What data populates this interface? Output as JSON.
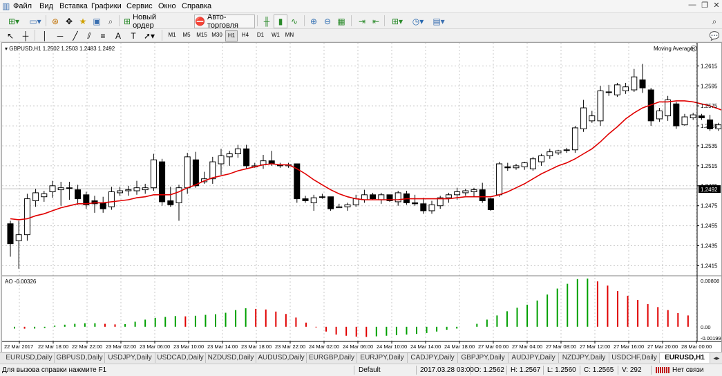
{
  "menu": {
    "items": [
      "Файл",
      "Вид",
      "Вставка",
      "Графики",
      "Сервис",
      "Окно",
      "Справка"
    ],
    "window_buttons": [
      "—",
      "❐",
      "✕"
    ]
  },
  "toolbar": {
    "new_order_label": "Новый ордер",
    "auto_trading_label": "Авто-торговля",
    "timeframes": [
      "M1",
      "M5",
      "M15",
      "M30",
      "H1",
      "H4",
      "D1",
      "W1",
      "MN"
    ],
    "active_timeframe": "H1"
  },
  "chart": {
    "header": "GBPUSD,H1  1.2502 1.2503 1.2483 1.2492",
    "indicator_label": "Moving Average",
    "ao_label": "AO -0.00326",
    "current_price_label": "1.2492",
    "colors": {
      "up": "#00a000",
      "down": "#e00000",
      "ma": "#e00000",
      "bid_line": "#c0c0c0"
    }
  },
  "chart_data": {
    "type": "candlestick",
    "symbol": "GBPUSD",
    "timeframe": "H1",
    "price_axis": {
      "ylim": [
        1.2407,
        1.2627
      ],
      "ticks": [
        "1.2615",
        "1.2595",
        "1.2575",
        "1.2555",
        "1.2535",
        "1.2515",
        "1.2495",
        "1.2475",
        "1.2455",
        "1.2435",
        "1.2415"
      ]
    },
    "current_price": 1.2492,
    "time_labels": [
      "22 Mar 2017",
      "22 Mar 18:00",
      "22 Mar 22:00",
      "23 Mar 02:00",
      "23 Mar 06:00",
      "23 Mar 10:00",
      "23 Mar 14:00",
      "23 Mar 18:00",
      "23 Mar 22:00",
      "24 Mar 02:00",
      "24 Mar 06:00",
      "24 Mar 10:00",
      "24 Mar 14:00",
      "24 Mar 18:00",
      "27 Mar 00:00",
      "27 Mar 04:00",
      "27 Mar 08:00",
      "27 Mar 12:00",
      "27 Mar 16:00",
      "27 Mar 20:00",
      "28 Mar 00:00"
    ],
    "candles": [
      [
        1.2457,
        1.246,
        1.2424,
        1.2437
      ],
      [
        1.244,
        1.246,
        1.2412,
        1.2446
      ],
      [
        1.2446,
        1.2487,
        1.244,
        1.2482
      ],
      [
        1.248,
        1.2492,
        1.2474,
        1.2488
      ],
      [
        1.2484,
        1.249,
        1.2479,
        1.2487
      ],
      [
        1.2489,
        1.25,
        1.2483,
        1.2495
      ],
      [
        1.2491,
        1.2499,
        1.2475,
        1.2493
      ],
      [
        1.2493,
        1.2499,
        1.2481,
        1.2493
      ],
      [
        1.2491,
        1.2496,
        1.2476,
        1.2482
      ],
      [
        1.2486,
        1.2489,
        1.2472,
        1.2476
      ],
      [
        1.248,
        1.2485,
        1.2468,
        1.2477
      ],
      [
        1.2478,
        1.2484,
        1.2468,
        1.2472
      ],
      [
        1.2474,
        1.2494,
        1.2471,
        1.2489
      ],
      [
        1.2488,
        1.2494,
        1.2485,
        1.249
      ],
      [
        1.249,
        1.2495,
        1.2485,
        1.2491
      ],
      [
        1.249,
        1.25,
        1.2486,
        1.2493
      ],
      [
        1.2491,
        1.2497,
        1.2487,
        1.2493
      ],
      [
        1.2493,
        1.2527,
        1.249,
        1.2521
      ],
      [
        1.2519,
        1.2522,
        1.2475,
        1.2479
      ],
      [
        1.248,
        1.2494,
        1.2474,
        1.2476
      ],
      [
        1.2478,
        1.2496,
        1.246,
        1.2493
      ],
      [
        1.2493,
        1.2528,
        1.2487,
        1.2524
      ],
      [
        1.2521,
        1.2529,
        1.2493,
        1.2495
      ],
      [
        1.2499,
        1.2509,
        1.2497,
        1.2502
      ],
      [
        1.2502,
        1.2524,
        1.2497,
        1.2519
      ],
      [
        1.2517,
        1.2532,
        1.2506,
        1.2525
      ],
      [
        1.2524,
        1.253,
        1.2515,
        1.2527
      ],
      [
        1.2527,
        1.2536,
        1.2523,
        1.2532
      ],
      [
        1.2532,
        1.2536,
        1.2512,
        1.2515
      ],
      [
        1.2514,
        1.2518,
        1.2513,
        1.2515
      ],
      [
        1.2516,
        1.2526,
        1.2512,
        1.252
      ],
      [
        1.252,
        1.253,
        1.2515,
        1.2517
      ],
      [
        1.2516,
        1.2518,
        1.2513,
        1.2515
      ],
      [
        1.2515,
        1.2518,
        1.2513,
        1.2516
      ],
      [
        1.2517,
        1.2517,
        1.2478,
        1.2482
      ],
      [
        1.2482,
        1.2485,
        1.2478,
        1.248
      ],
      [
        1.2478,
        1.2486,
        1.247,
        1.2483
      ],
      [
        1.2484,
        1.2487,
        1.2482,
        1.2484
      ],
      [
        1.2484,
        1.2484,
        1.247,
        1.2472
      ],
      [
        1.2473,
        1.2477,
        1.2473,
        1.2474
      ],
      [
        1.2474,
        1.2478,
        1.247,
        1.2476
      ],
      [
        1.2476,
        1.2486,
        1.2474,
        1.2482
      ],
      [
        1.2481,
        1.2491,
        1.2478,
        1.2486
      ],
      [
        1.2486,
        1.2488,
        1.2481,
        1.2482
      ],
      [
        1.2481,
        1.2488,
        1.2477,
        1.2486
      ],
      [
        1.2486,
        1.2486,
        1.2479,
        1.248
      ],
      [
        1.2479,
        1.249,
        1.2475,
        1.2488
      ],
      [
        1.2487,
        1.249,
        1.2476,
        1.2478
      ],
      [
        1.2478,
        1.2486,
        1.2475,
        1.2477
      ],
      [
        1.2477,
        1.2483,
        1.2467,
        1.247
      ],
      [
        1.247,
        1.248,
        1.2467,
        1.2476
      ],
      [
        1.2475,
        1.2485,
        1.2472,
        1.2483
      ],
      [
        1.2483,
        1.2488,
        1.2478,
        1.2486
      ],
      [
        1.2486,
        1.2493,
        1.2481,
        1.2489
      ],
      [
        1.2488,
        1.2492,
        1.2485,
        1.249
      ],
      [
        1.2489,
        1.2493,
        1.2484,
        1.2491
      ],
      [
        1.2491,
        1.2498,
        1.2478,
        1.248
      ],
      [
        1.2482,
        1.2483,
        1.247,
        1.2471
      ],
      [
        1.2486,
        1.2519,
        1.2484,
        1.2517
      ],
      [
        1.2514,
        1.2518,
        1.251,
        1.2513
      ],
      [
        1.2513,
        1.2517,
        1.2511,
        1.2515
      ],
      [
        1.2514,
        1.2519,
        1.2511,
        1.2518
      ],
      [
        1.2512,
        1.2524,
        1.251,
        1.2522
      ],
      [
        1.2519,
        1.2527,
        1.2515,
        1.2525
      ],
      [
        1.2525,
        1.2532,
        1.2522,
        1.2529
      ],
      [
        1.2528,
        1.2531,
        1.2526,
        1.253
      ],
      [
        1.2531,
        1.2533,
        1.2528,
        1.2531
      ],
      [
        1.2531,
        1.2555,
        1.2528,
        1.2553
      ],
      [
        1.2552,
        1.2581,
        1.2549,
        1.2573
      ],
      [
        1.256,
        1.257,
        1.2558,
        1.2565
      ],
      [
        1.256,
        1.2595,
        1.2555,
        1.259
      ],
      [
        1.2589,
        1.2596,
        1.2585,
        1.2589
      ],
      [
        1.2586,
        1.2598,
        1.2584,
        1.2596
      ],
      [
        1.259,
        1.2598,
        1.2587,
        1.2594
      ],
      [
        1.2591,
        1.2612,
        1.2589,
        1.2604
      ],
      [
        1.2601,
        1.2617,
        1.2588,
        1.2593
      ],
      [
        1.2591,
        1.2593,
        1.2555,
        1.256
      ],
      [
        1.2562,
        1.2573,
        1.2559,
        1.257
      ],
      [
        1.2565,
        1.2585,
        1.256,
        1.2581
      ],
      [
        1.2577,
        1.2579,
        1.2552,
        1.2555
      ],
      [
        1.2556,
        1.2567,
        1.2555,
        1.2564
      ],
      [
        1.2563,
        1.2568,
        1.2561,
        1.2566
      ],
      [
        1.2565,
        1.2567,
        1.2561,
        1.2563
      ],
      [
        1.2561,
        1.2566,
        1.255,
        1.2552
      ],
      [
        1.2552,
        1.2558,
        1.255,
        1.2556
      ],
      [
        1.2555,
        1.2557,
        1.2553,
        1.2555
      ],
      [
        1.2557,
        1.2557,
        1.2552,
        1.2553
      ],
      [
        1.2553,
        1.2557,
        1.255,
        1.2555
      ],
      [
        1.2555,
        1.2558,
        1.2552,
        1.2557
      ]
    ],
    "moving_average": [
      1.2462,
      1.2461,
      1.2462,
      1.2465,
      1.2467,
      1.247,
      1.2473,
      1.2475,
      1.2477,
      1.2477,
      1.2478,
      1.2478,
      1.2479,
      1.248,
      1.2481,
      1.2483,
      1.2484,
      1.2486,
      1.2486,
      1.2486,
      1.2489,
      1.2493,
      1.2496,
      1.25,
      1.2503,
      1.2505,
      1.2507,
      1.251,
      1.2512,
      1.2514,
      1.2516,
      1.2517,
      1.2516,
      1.2516,
      1.2512,
      1.2507,
      1.2501,
      1.2496,
      1.2491,
      1.2487,
      1.2484,
      1.2482,
      1.2481,
      1.2481,
      1.2481,
      1.2481,
      1.2481,
      1.2482,
      1.2482,
      1.2482,
      1.2482,
      1.2482,
      1.2482,
      1.2483,
      1.2484,
      1.2484,
      1.2484,
      1.2484,
      1.2486,
      1.2489,
      1.2493,
      1.2497,
      1.2502,
      1.2507,
      1.2511,
      1.2515,
      1.2518,
      1.2522,
      1.2527,
      1.2532,
      1.2539,
      1.2547,
      1.2554,
      1.2562,
      1.2568,
      1.2573,
      1.2576,
      1.2579,
      1.2579,
      1.258,
      1.258,
      1.2579,
      1.2577,
      1.2575,
      1.2572,
      1.2569,
      1.2565,
      1.2563,
      1.2562
    ],
    "ao_axis": {
      "ylim": [
        -0.00199,
        0.00808
      ],
      "ticks": [
        "0.00808",
        "0.00",
        "-0.00199"
      ]
    },
    "ao": [
      -0.0003,
      -0.00032,
      -0.0003,
      -0.0002,
      0.0002,
      0.00035,
      0.0005,
      0.0006,
      0.0006,
      0.0005,
      0.0004,
      0.00045,
      0.00085,
      0.0012,
      0.0015,
      0.00165,
      0.0018,
      0.00175,
      0.00185,
      0.002,
      0.0021,
      0.00235,
      0.0028,
      0.0031,
      0.003,
      0.0029,
      0.00255,
      0.00215,
      0.00155,
      0.0007,
      -0.0001,
      -0.0008,
      -0.0013,
      -0.0015,
      -0.00165,
      -0.0017,
      -0.0016,
      -0.0015,
      -0.0014,
      -0.0013,
      -0.0012,
      -0.00105,
      -0.0008,
      -0.0005,
      -0.0003,
      0.0,
      0.0005,
      0.0012,
      0.0019,
      0.0026,
      0.0032,
      0.0037,
      0.0044,
      0.0054,
      0.0064,
      0.0072,
      0.008,
      0.00808,
      0.0076,
      0.0069,
      0.006,
      0.0052,
      0.0045,
      0.0038,
      0.0033,
      0.0028,
      0.0023,
      0.0019
    ]
  },
  "symbol_tabs": [
    "EURUSD,Daily",
    "GBPUSD,Daily",
    "USDJPY,Daily",
    "USDCAD,Daily",
    "NZDUSD,Daily",
    "AUDUSD,Daily",
    "EURGBP,Daily",
    "EURJPY,Daily",
    "CADJPY,Daily",
    "GBPJPY,Daily",
    "AUDJPY,Daily",
    "NZDJPY,Daily",
    "USDCHF,Daily",
    "EURUSD,H1"
  ],
  "status": {
    "help": "Для вызова справки нажмите F1",
    "profile": "Default",
    "datetime": "2017.03.28 03:00",
    "open": "O: 1.2562",
    "high": "H: 1.2567",
    "low": "L: 1.2560",
    "close": "C: 1.2565",
    "volume": "V: 292",
    "connection": "Нет связи"
  }
}
